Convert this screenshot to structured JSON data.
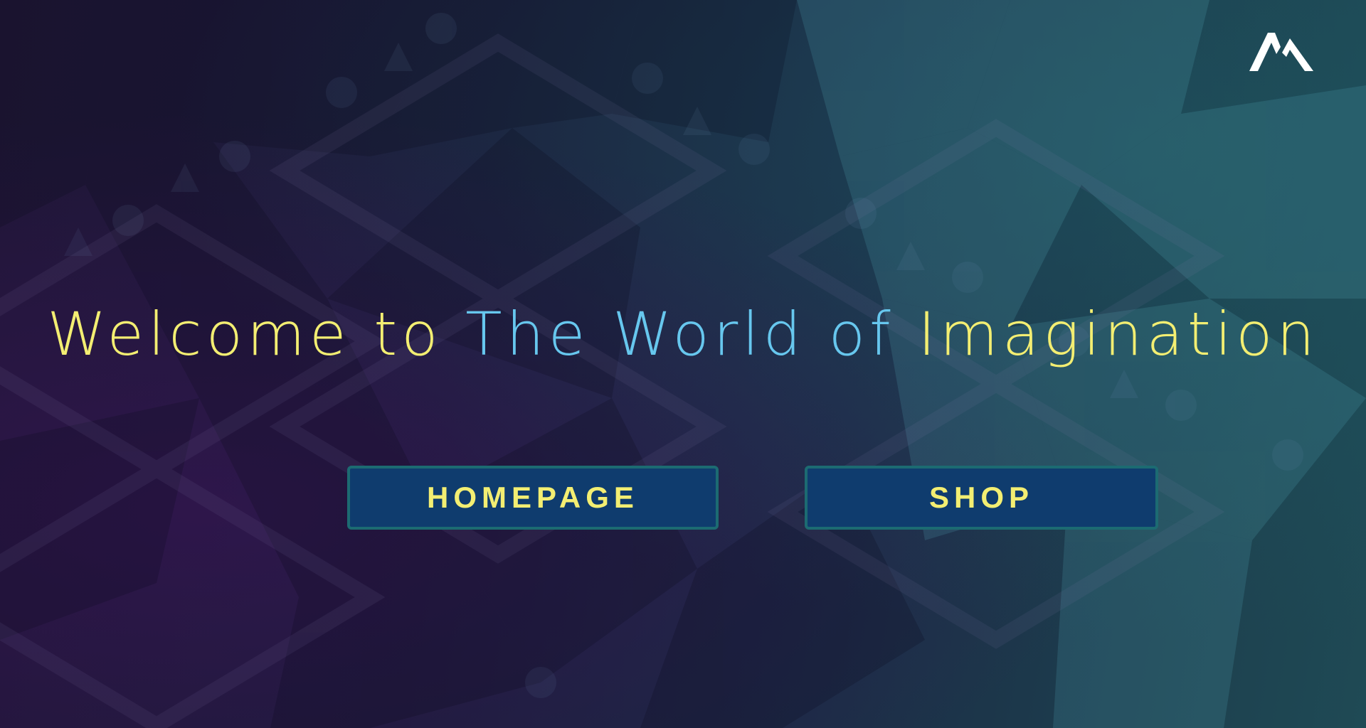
{
  "header": {
    "logo_icon": "m-logo-icon"
  },
  "hero": {
    "title_part_1": "Welcome to ",
    "title_part_2": "The World of",
    "title_part_3": " Imagination",
    "title_color_primary": "#f3ee72",
    "title_color_accent": "#67c7ee"
  },
  "actions": {
    "homepage_label": "HOMEPAGE",
    "shop_label": "SHOP",
    "button_bg": "#0f3c6e",
    "button_border": "#1c6b72"
  }
}
